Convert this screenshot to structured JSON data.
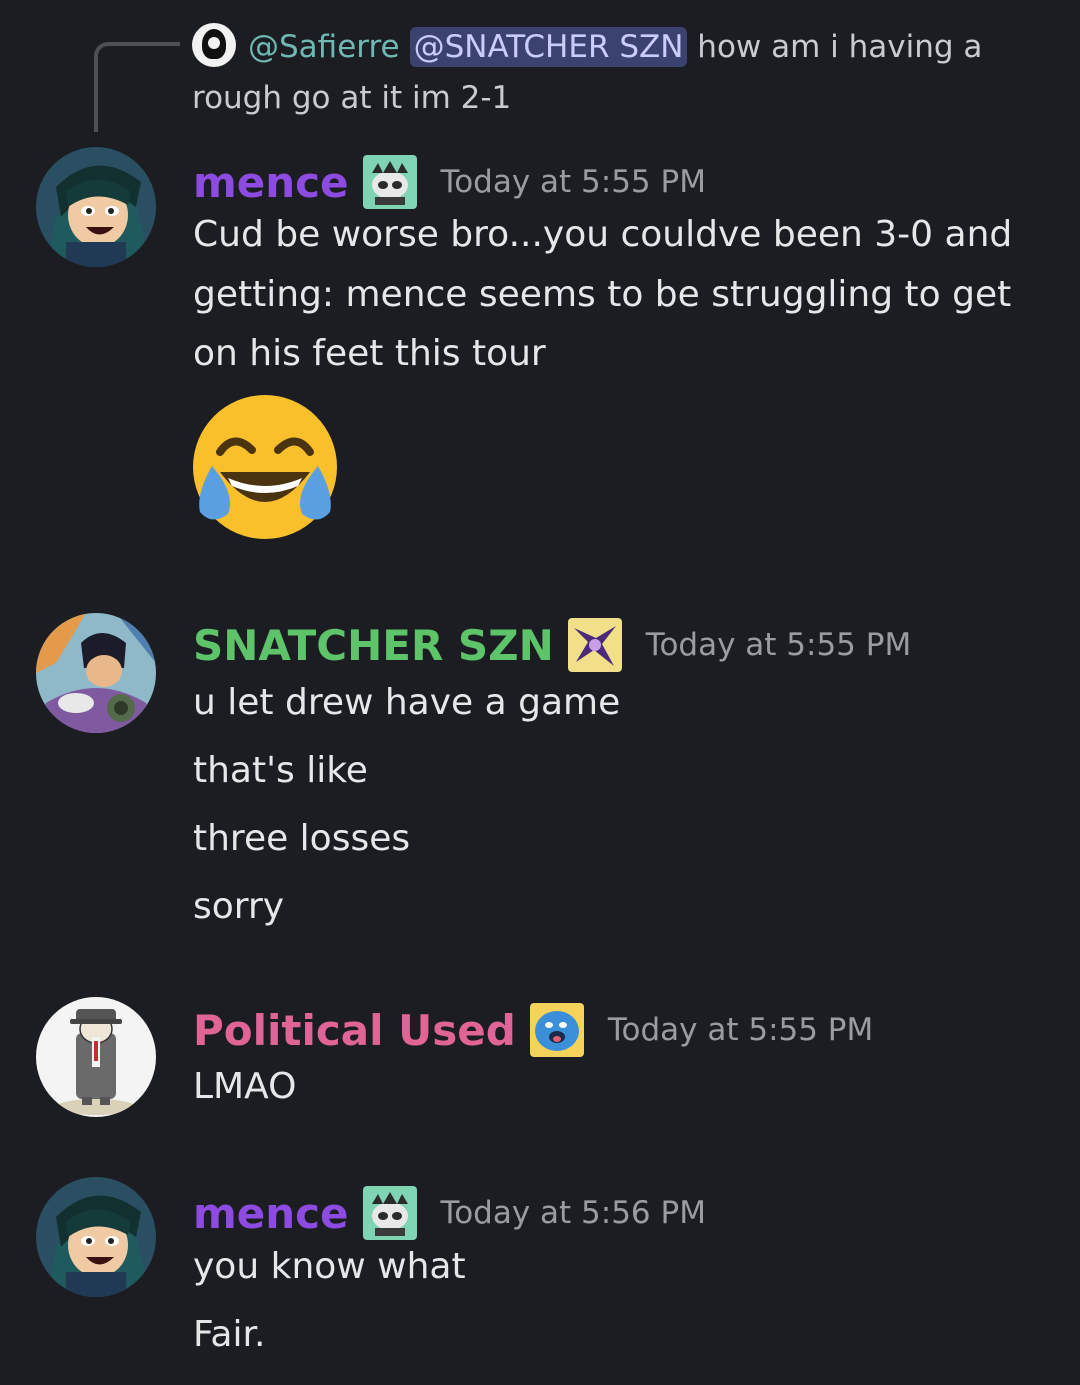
{
  "reply": {
    "author": "@Safierre",
    "mention": "@SNATCHER SZN",
    "text_1": "how am i having a",
    "text_2": "rough go at it im 2-1"
  },
  "messages": [
    {
      "username": "mence",
      "username_color": "#8e4be2",
      "timestamp": "Today at 5:55 PM",
      "lines": [
        "Cud be worse bro...you couldve been 3-0 and",
        "getting:  mence seems to be struggling to get",
        "on his feet this tour"
      ],
      "emoji": "joy-emoji"
    },
    {
      "username": "SNATCHER SZN",
      "username_color": "#5dc469",
      "timestamp": "Today at 5:55 PM",
      "lines": [
        "u let drew have a game",
        "that's like",
        "three losses",
        "sorry"
      ]
    },
    {
      "username": "Political Used",
      "username_color": "#e06596",
      "timestamp": "Today at 5:55 PM",
      "lines": [
        "LMAO"
      ]
    },
    {
      "username": "mence",
      "username_color": "#8e4be2",
      "timestamp": "Today at 5:56 PM",
      "lines": [
        "you know what",
        "Fair."
      ]
    }
  ]
}
